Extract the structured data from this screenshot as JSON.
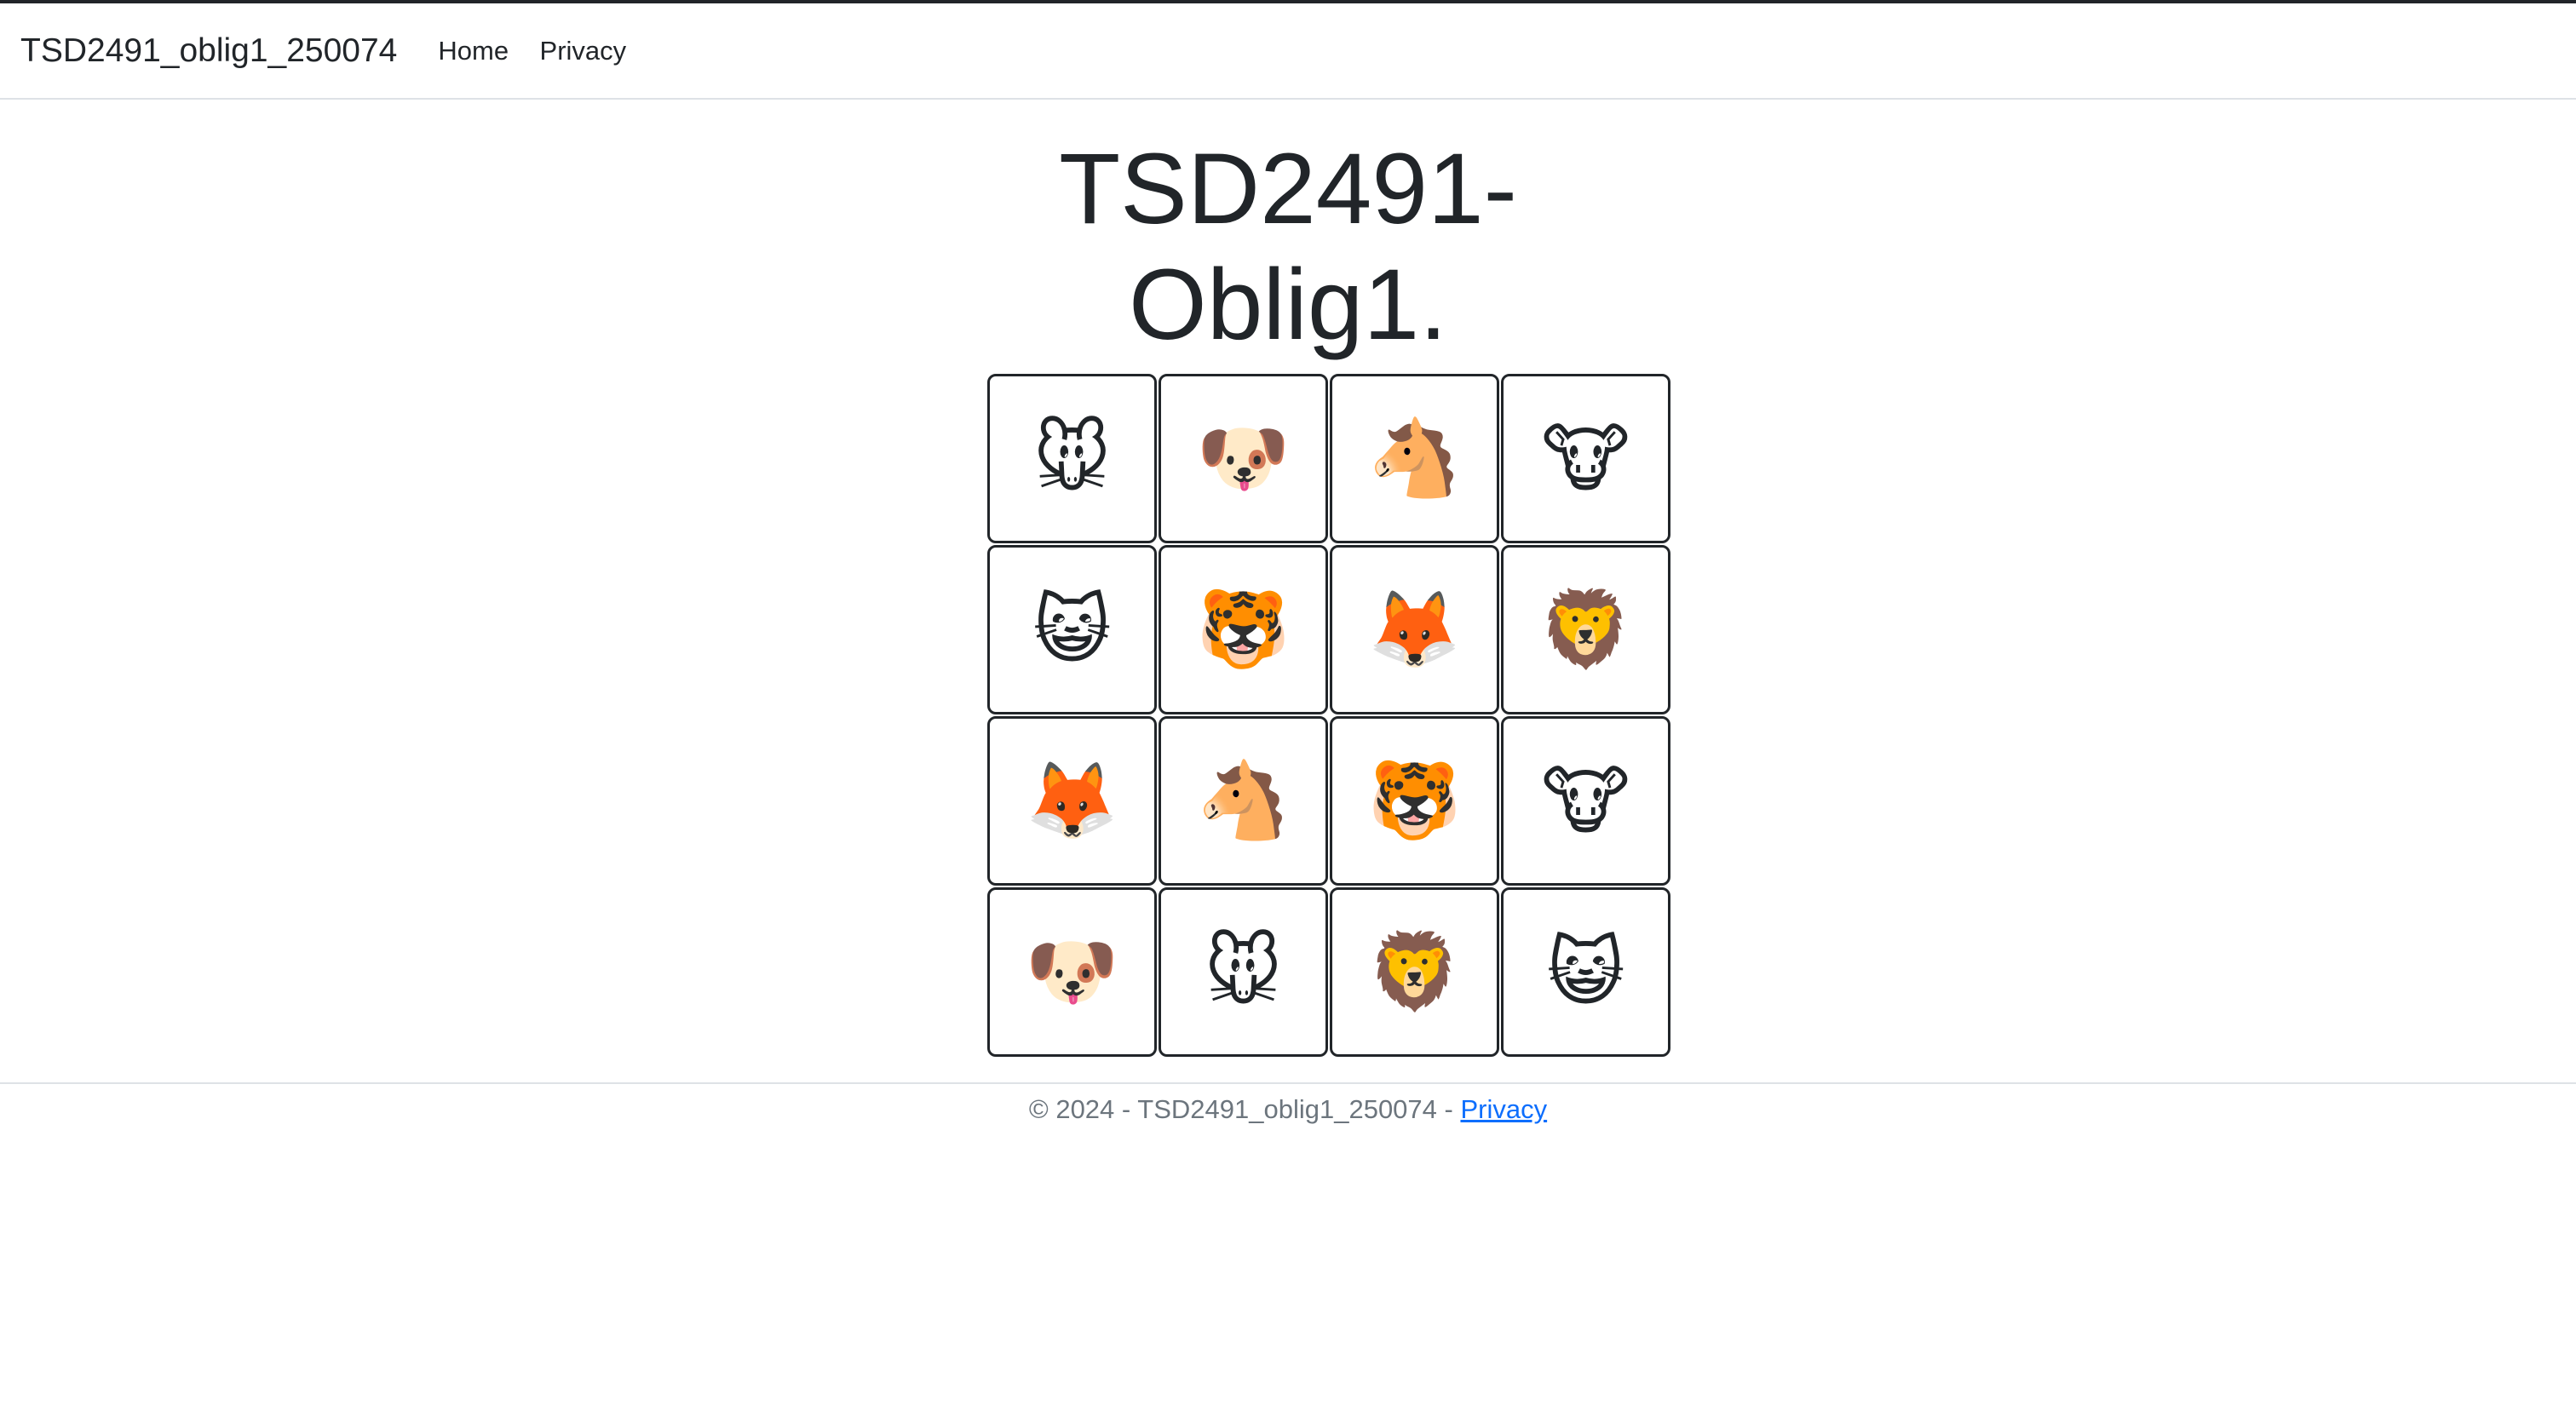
{
  "navbar": {
    "brand": "TSD2491_oblig1_250074",
    "links": [
      "Home",
      "Privacy"
    ]
  },
  "main": {
    "title_line1": "TSD2491-",
    "title_line2": "Oblig1.",
    "cards": [
      {
        "emoji": "🐭",
        "icon": "mouse-face"
      },
      {
        "emoji": "🐶",
        "icon": "dog-face"
      },
      {
        "emoji": "🐴",
        "icon": "horse-face"
      },
      {
        "emoji": "🐮",
        "icon": "cow-face"
      },
      {
        "emoji": "😺",
        "icon": "cat-face"
      },
      {
        "emoji": "🐯",
        "icon": "tiger-face"
      },
      {
        "emoji": "🦊",
        "icon": "fox-face"
      },
      {
        "emoji": "🦁",
        "icon": "lion-face"
      },
      {
        "emoji": "🦊",
        "icon": "fox-face"
      },
      {
        "emoji": "🐴",
        "icon": "horse-face"
      },
      {
        "emoji": "🐯",
        "icon": "tiger-face"
      },
      {
        "emoji": "🐮",
        "icon": "cow-face"
      },
      {
        "emoji": "🐶",
        "icon": "dog-face"
      },
      {
        "emoji": "🐭",
        "icon": "mouse-face"
      },
      {
        "emoji": "🦁",
        "icon": "lion-face"
      },
      {
        "emoji": "😺",
        "icon": "cat-face"
      }
    ]
  },
  "footer": {
    "text": "© 2024 - TSD2491_oblig1_250074 - ",
    "privacy_link": "Privacy"
  }
}
